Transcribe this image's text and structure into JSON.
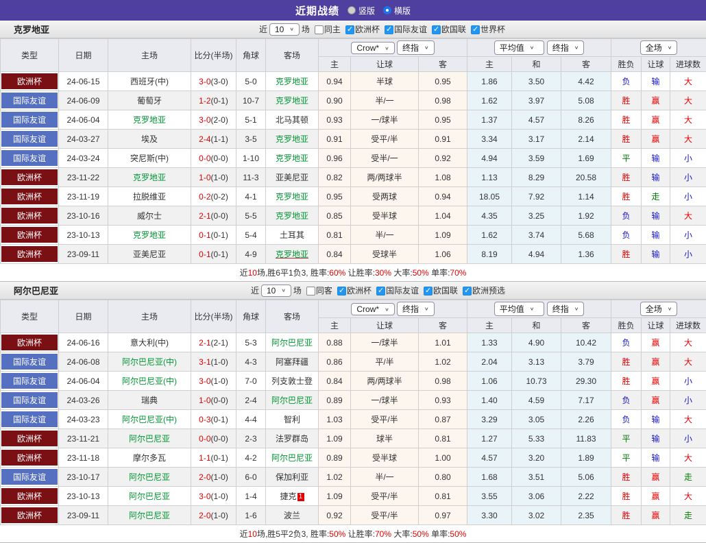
{
  "title_bar": {
    "title": "近期战绩",
    "radios": [
      {
        "label": "竖版",
        "selected": false
      },
      {
        "label": "横版",
        "selected": true
      }
    ]
  },
  "colors": {
    "top_bar": "#4f3f9f",
    "league_cup_badge": "#7a1014",
    "league_friendly_badge": "#5570c0",
    "team_link_green": "#009933",
    "win_red": "#e60000",
    "loss_blue": "#1414cc",
    "draw_green": "#008000",
    "handicap_column_bg": "#fcf6ee",
    "average_column_bg": "#e9f4f8",
    "checkbox_blue": "#2196f3"
  },
  "table_header": {
    "col_type": "类型",
    "col_date": "日期",
    "col_home": "主场",
    "col_score": "比分(半场)",
    "col_corner": "角球",
    "col_away": "客场",
    "dd_bookmaker": "Crow*",
    "dd_final1": "终指",
    "dd_average": "平均值",
    "dd_final2": "终指",
    "dd_fullmatch": "全场",
    "sub": [
      "主",
      "让球",
      "客",
      "主",
      "和",
      "客",
      "胜负",
      "让球",
      "进球数"
    ]
  },
  "sections": [
    {
      "team": "克罗地亚",
      "controls": {
        "recent_label": "近",
        "count": "10",
        "games_label": "场",
        "same_label": "同主",
        "same_checked": false,
        "leagues": [
          {
            "label": "欧洲杯",
            "checked": true
          },
          {
            "label": "国际友谊",
            "checked": true
          },
          {
            "label": "欧国联",
            "checked": true
          },
          {
            "label": "世界杯",
            "checked": true
          }
        ]
      },
      "rows": [
        {
          "league": "欧洲杯",
          "league_type": "cup",
          "date": "24-06-15",
          "home": "西班牙(中)",
          "home_highlight": false,
          "score": "3-0",
          "half": "(3-0)",
          "corners": "5-0",
          "away": "克罗地亚",
          "away_highlight": true,
          "odds_home": "0.94",
          "handicap": "半球",
          "odds_away": "0.95",
          "avg_home": "1.86",
          "avg_draw": "3.50",
          "avg_away": "4.42",
          "outcome": {
            "text": "负",
            "color": "blue"
          },
          "handicap_result": {
            "text": "输",
            "color": "blue"
          },
          "goals_result": {
            "text": "大",
            "color": "red"
          }
        },
        {
          "league": "国际友谊",
          "league_type": "friendly",
          "date": "24-06-09",
          "home": "葡萄牙",
          "home_highlight": false,
          "score": "1-2",
          "half": "(0-1)",
          "corners": "10-7",
          "away": "克罗地亚",
          "away_highlight": true,
          "odds_home": "0.90",
          "handicap": "半/一",
          "odds_away": "0.98",
          "avg_home": "1.62",
          "avg_draw": "3.97",
          "avg_away": "5.08",
          "outcome": {
            "text": "胜",
            "color": "red"
          },
          "handicap_result": {
            "text": "赢",
            "color": "red"
          },
          "goals_result": {
            "text": "大",
            "color": "red"
          }
        },
        {
          "league": "国际友谊",
          "league_type": "friendly",
          "date": "24-06-04",
          "home": "克罗地亚",
          "home_highlight": true,
          "score": "3-0",
          "half": "(2-0)",
          "corners": "5-1",
          "away": "北马其顿",
          "away_highlight": false,
          "odds_home": "0.93",
          "handicap": "一/球半",
          "odds_away": "0.95",
          "avg_home": "1.37",
          "avg_draw": "4.57",
          "avg_away": "8.26",
          "outcome": {
            "text": "胜",
            "color": "red"
          },
          "handicap_result": {
            "text": "赢",
            "color": "red"
          },
          "goals_result": {
            "text": "大",
            "color": "red"
          }
        },
        {
          "league": "国际友谊",
          "league_type": "friendly",
          "date": "24-03-27",
          "home": "埃及",
          "home_highlight": false,
          "score": "2-4",
          "half": "(1-1)",
          "corners": "3-5",
          "away": "克罗地亚",
          "away_highlight": true,
          "odds_home": "0.91",
          "handicap": "受平/半",
          "odds_away": "0.91",
          "avg_home": "3.34",
          "avg_draw": "3.17",
          "avg_away": "2.14",
          "outcome": {
            "text": "胜",
            "color": "red"
          },
          "handicap_result": {
            "text": "赢",
            "color": "red"
          },
          "goals_result": {
            "text": "大",
            "color": "red"
          }
        },
        {
          "league": "国际友谊",
          "league_type": "friendly",
          "date": "24-03-24",
          "home": "突尼斯(中)",
          "home_highlight": false,
          "score": "0-0",
          "half": "(0-0)",
          "corners": "1-10",
          "away": "克罗地亚",
          "away_highlight": true,
          "odds_home": "0.96",
          "handicap": "受半/一",
          "odds_away": "0.92",
          "avg_home": "4.94",
          "avg_draw": "3.59",
          "avg_away": "1.69",
          "outcome": {
            "text": "平",
            "color": "green"
          },
          "handicap_result": {
            "text": "输",
            "color": "blue"
          },
          "goals_result": {
            "text": "小",
            "color": "blue"
          }
        },
        {
          "league": "欧洲杯",
          "league_type": "cup",
          "date": "23-11-22",
          "home": "克罗地亚",
          "home_highlight": true,
          "score": "1-0",
          "half": "(1-0)",
          "corners": "11-3",
          "away": "亚美尼亚",
          "away_highlight": false,
          "odds_home": "0.82",
          "handicap": "两/两球半",
          "odds_away": "1.08",
          "avg_home": "1.13",
          "avg_draw": "8.29",
          "avg_away": "20.58",
          "outcome": {
            "text": "胜",
            "color": "red"
          },
          "handicap_result": {
            "text": "输",
            "color": "blue"
          },
          "goals_result": {
            "text": "小",
            "color": "blue"
          }
        },
        {
          "league": "欧洲杯",
          "league_type": "cup",
          "date": "23-11-19",
          "home": "拉脱维亚",
          "home_highlight": false,
          "score": "0-2",
          "half": "(0-2)",
          "corners": "4-1",
          "away": "克罗地亚",
          "away_highlight": true,
          "odds_home": "0.95",
          "handicap": "受两球",
          "odds_away": "0.94",
          "avg_home": "18.05",
          "avg_draw": "7.92",
          "avg_away": "1.14",
          "outcome": {
            "text": "胜",
            "color": "red"
          },
          "handicap_result": {
            "text": "走",
            "color": "green"
          },
          "goals_result": {
            "text": "小",
            "color": "blue"
          }
        },
        {
          "league": "欧洲杯",
          "league_type": "cup",
          "date": "23-10-16",
          "home": "威尔士",
          "home_highlight": false,
          "score": "2-1",
          "half": "(0-0)",
          "corners": "5-5",
          "away": "克罗地亚",
          "away_highlight": true,
          "odds_home": "0.85",
          "handicap": "受半球",
          "odds_away": "1.04",
          "avg_home": "4.35",
          "avg_draw": "3.25",
          "avg_away": "1.92",
          "outcome": {
            "text": "负",
            "color": "blue"
          },
          "handicap_result": {
            "text": "输",
            "color": "blue"
          },
          "goals_result": {
            "text": "大",
            "color": "red"
          }
        },
        {
          "league": "欧洲杯",
          "league_type": "cup",
          "date": "23-10-13",
          "home": "克罗地亚",
          "home_highlight": true,
          "score": "0-1",
          "half": "(0-1)",
          "corners": "5-4",
          "away": "土耳其",
          "away_highlight": false,
          "odds_home": "0.81",
          "handicap": "半/一",
          "odds_away": "1.09",
          "avg_home": "1.62",
          "avg_draw": "3.74",
          "avg_away": "5.68",
          "outcome": {
            "text": "负",
            "color": "blue"
          },
          "handicap_result": {
            "text": "输",
            "color": "blue"
          },
          "goals_result": {
            "text": "小",
            "color": "blue"
          }
        },
        {
          "league": "欧洲杯",
          "league_type": "cup",
          "date": "23-09-11",
          "home": "亚美尼亚",
          "home_highlight": false,
          "score": "0-1",
          "half": "(0-1)",
          "corners": "4-9",
          "away": "克罗地亚",
          "away_highlight": true,
          "away_underline": true,
          "odds_home": "0.84",
          "handicap": "受球半",
          "odds_away": "1.06",
          "avg_home": "8.19",
          "avg_draw": "4.94",
          "avg_away": "1.36",
          "outcome": {
            "text": "胜",
            "color": "red"
          },
          "handicap_result": {
            "text": "输",
            "color": "blue"
          },
          "goals_result": {
            "text": "小",
            "color": "blue"
          }
        }
      ],
      "summary": [
        {
          "text": "近",
          "color": "black"
        },
        {
          "text": "10",
          "color": "red"
        },
        {
          "text": "场,胜6平1负3, 胜率:",
          "color": "black"
        },
        {
          "text": "60%",
          "color": "red"
        },
        {
          "text": " 让胜率:",
          "color": "black"
        },
        {
          "text": "30%",
          "color": "red"
        },
        {
          "text": " 大率:",
          "color": "black"
        },
        {
          "text": "50%",
          "color": "red"
        },
        {
          "text": " 单率:",
          "color": "black"
        },
        {
          "text": "70%",
          "color": "red"
        }
      ]
    },
    {
      "team": "阿尔巴尼亚",
      "controls": {
        "recent_label": "近",
        "count": "10",
        "games_label": "场",
        "same_label": "同客",
        "same_checked": false,
        "leagues": [
          {
            "label": "欧洲杯",
            "checked": true
          },
          {
            "label": "国际友谊",
            "checked": true
          },
          {
            "label": "欧国联",
            "checked": true
          },
          {
            "label": "欧洲预选",
            "checked": true
          }
        ]
      },
      "rows": [
        {
          "league": "欧洲杯",
          "league_type": "cup",
          "date": "24-06-16",
          "home": "意大利(中)",
          "home_highlight": false,
          "score": "2-1",
          "half": "(2-1)",
          "corners": "5-3",
          "away": "阿尔巴尼亚",
          "away_highlight": true,
          "odds_home": "0.88",
          "handicap": "一/球半",
          "odds_away": "1.01",
          "avg_home": "1.33",
          "avg_draw": "4.90",
          "avg_away": "10.42",
          "outcome": {
            "text": "负",
            "color": "blue"
          },
          "handicap_result": {
            "text": "赢",
            "color": "red"
          },
          "goals_result": {
            "text": "大",
            "color": "red"
          }
        },
        {
          "league": "国际友谊",
          "league_type": "friendly",
          "date": "24-06-08",
          "home": "阿尔巴尼亚(中)",
          "home_highlight": true,
          "score": "3-1",
          "half": "(1-0)",
          "corners": "4-3",
          "away": "阿塞拜疆",
          "away_highlight": false,
          "odds_home": "0.86",
          "handicap": "平/半",
          "odds_away": "1.02",
          "avg_home": "2.04",
          "avg_draw": "3.13",
          "avg_away": "3.79",
          "outcome": {
            "text": "胜",
            "color": "red"
          },
          "handicap_result": {
            "text": "赢",
            "color": "red"
          },
          "goals_result": {
            "text": "大",
            "color": "red"
          }
        },
        {
          "league": "国际友谊",
          "league_type": "friendly",
          "date": "24-06-04",
          "home": "阿尔巴尼亚(中)",
          "home_highlight": true,
          "score": "3-0",
          "half": "(1-0)",
          "corners": "7-0",
          "away": "列支敦士登",
          "away_highlight": false,
          "odds_home": "0.84",
          "handicap": "两/两球半",
          "odds_away": "0.98",
          "avg_home": "1.06",
          "avg_draw": "10.73",
          "avg_away": "29.30",
          "outcome": {
            "text": "胜",
            "color": "red"
          },
          "handicap_result": {
            "text": "赢",
            "color": "red"
          },
          "goals_result": {
            "text": "小",
            "color": "blue"
          }
        },
        {
          "league": "国际友谊",
          "league_type": "friendly",
          "date": "24-03-26",
          "home": "瑞典",
          "home_highlight": false,
          "score": "1-0",
          "half": "(0-0)",
          "corners": "2-4",
          "away": "阿尔巴尼亚",
          "away_highlight": true,
          "odds_home": "0.89",
          "handicap": "一/球半",
          "odds_away": "0.93",
          "avg_home": "1.40",
          "avg_draw": "4.59",
          "avg_away": "7.17",
          "outcome": {
            "text": "负",
            "color": "blue"
          },
          "handicap_result": {
            "text": "赢",
            "color": "red"
          },
          "goals_result": {
            "text": "小",
            "color": "blue"
          }
        },
        {
          "league": "国际友谊",
          "league_type": "friendly",
          "date": "24-03-23",
          "home": "阿尔巴尼亚(中)",
          "home_highlight": true,
          "score": "0-3",
          "half": "(0-1)",
          "corners": "4-4",
          "away": "智利",
          "away_highlight": false,
          "odds_home": "1.03",
          "handicap": "受平/半",
          "odds_away": "0.87",
          "avg_home": "3.29",
          "avg_draw": "3.05",
          "avg_away": "2.26",
          "outcome": {
            "text": "负",
            "color": "blue"
          },
          "handicap_result": {
            "text": "输",
            "color": "blue"
          },
          "goals_result": {
            "text": "大",
            "color": "red"
          }
        },
        {
          "league": "欧洲杯",
          "league_type": "cup",
          "date": "23-11-21",
          "home": "阿尔巴尼亚",
          "home_highlight": true,
          "score": "0-0",
          "half": "(0-0)",
          "corners": "2-3",
          "away": "法罗群岛",
          "away_highlight": false,
          "odds_home": "1.09",
          "handicap": "球半",
          "odds_away": "0.81",
          "avg_home": "1.27",
          "avg_draw": "5.33",
          "avg_away": "11.83",
          "outcome": {
            "text": "平",
            "color": "green"
          },
          "handicap_result": {
            "text": "输",
            "color": "blue"
          },
          "goals_result": {
            "text": "小",
            "color": "blue"
          }
        },
        {
          "league": "欧洲杯",
          "league_type": "cup",
          "date": "23-11-18",
          "home": "摩尔多瓦",
          "home_highlight": false,
          "score": "1-1",
          "half": "(0-1)",
          "corners": "4-2",
          "away": "阿尔巴尼亚",
          "away_highlight": true,
          "odds_home": "0.89",
          "handicap": "受半球",
          "odds_away": "1.00",
          "avg_home": "4.57",
          "avg_draw": "3.20",
          "avg_away": "1.89",
          "outcome": {
            "text": "平",
            "color": "green"
          },
          "handicap_result": {
            "text": "输",
            "color": "blue"
          },
          "goals_result": {
            "text": "大",
            "color": "red"
          }
        },
        {
          "league": "国际友谊",
          "league_type": "friendly",
          "date": "23-10-17",
          "home": "阿尔巴尼亚",
          "home_highlight": true,
          "score": "2-0",
          "half": "(1-0)",
          "corners": "6-0",
          "away": "保加利亚",
          "away_highlight": false,
          "odds_home": "1.02",
          "handicap": "半/一",
          "odds_away": "0.80",
          "avg_home": "1.68",
          "avg_draw": "3.51",
          "avg_away": "5.06",
          "outcome": {
            "text": "胜",
            "color": "red"
          },
          "handicap_result": {
            "text": "赢",
            "color": "red"
          },
          "goals_result": {
            "text": "走",
            "color": "green"
          }
        },
        {
          "league": "欧洲杯",
          "league_type": "cup",
          "date": "23-10-13",
          "home": "阿尔巴尼亚",
          "home_highlight": true,
          "score": "3-0",
          "half": "(1-0)",
          "corners": "1-4",
          "away": "捷克",
          "away_highlight": false,
          "red_card": "1",
          "odds_home": "1.09",
          "handicap": "受平/半",
          "odds_away": "0.81",
          "avg_home": "3.55",
          "avg_draw": "3.06",
          "avg_away": "2.22",
          "outcome": {
            "text": "胜",
            "color": "red"
          },
          "handicap_result": {
            "text": "赢",
            "color": "red"
          },
          "goals_result": {
            "text": "大",
            "color": "red"
          }
        },
        {
          "league": "欧洲杯",
          "league_type": "cup",
          "date": "23-09-11",
          "home": "阿尔巴尼亚",
          "home_highlight": true,
          "score": "2-0",
          "half": "(1-0)",
          "corners": "1-6",
          "away": "波兰",
          "away_highlight": false,
          "odds_home": "0.92",
          "handicap": "受平/半",
          "odds_away": "0.97",
          "avg_home": "3.30",
          "avg_draw": "3.02",
          "avg_away": "2.35",
          "outcome": {
            "text": "胜",
            "color": "red"
          },
          "handicap_result": {
            "text": "赢",
            "color": "red"
          },
          "goals_result": {
            "text": "走",
            "color": "green"
          }
        }
      ],
      "summary": [
        {
          "text": "近",
          "color": "black"
        },
        {
          "text": "10",
          "color": "red"
        },
        {
          "text": "场,胜5平2负3, 胜率:",
          "color": "black"
        },
        {
          "text": "50%",
          "color": "red"
        },
        {
          "text": " 让胜率:",
          "color": "black"
        },
        {
          "text": "70%",
          "color": "red"
        },
        {
          "text": " 大率:",
          "color": "black"
        },
        {
          "text": "50%",
          "color": "red"
        },
        {
          "text": " 单率:",
          "color": "black"
        },
        {
          "text": "50%",
          "color": "red"
        }
      ]
    }
  ]
}
